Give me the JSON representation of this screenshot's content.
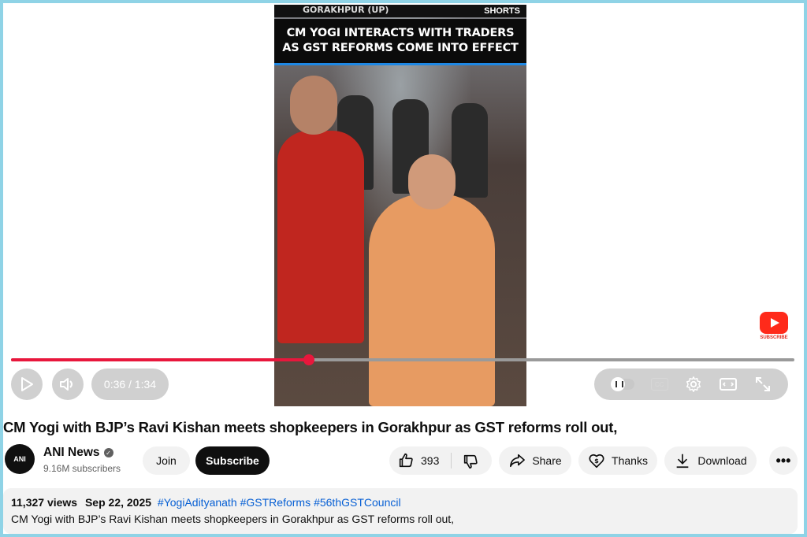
{
  "video": {
    "location_label": "GORAKHPUR (UP)",
    "shorts_label": "SHORTS",
    "headline_line1": "CM YOGI INTERACTS WITH TRADERS",
    "headline_line2": "AS GST REFORMS COME INTO EFFECT",
    "subscribe_watermark": "SUBSCRIBE"
  },
  "player": {
    "progress": 0.38,
    "time_display": "0:36 / 1:34",
    "colors": {
      "progress": "#e8173c",
      "track": "#9a9a9a"
    }
  },
  "title": "CM Yogi with BJP’s Ravi Kishan meets shopkeepers in Gorakhpur as GST reforms roll out,",
  "channel": {
    "avatar_text": "ANI",
    "name": "ANI News",
    "subscribers": "9.16M subscribers",
    "join_label": "Join",
    "subscribe_label": "Subscribe"
  },
  "actions": {
    "like_count": "393",
    "share_label": "Share",
    "thanks_label": "Thanks",
    "download_label": "Download",
    "more_label": "•••"
  },
  "description": {
    "views": "11,327 views",
    "date": "Sep 22, 2025",
    "hashtags": [
      "#YogiAdityanath",
      "#GSTReforms",
      "#56thGSTCouncil"
    ],
    "text": "CM Yogi with BJP’s Ravi Kishan meets shopkeepers in Gorakhpur as GST reforms roll out,"
  }
}
